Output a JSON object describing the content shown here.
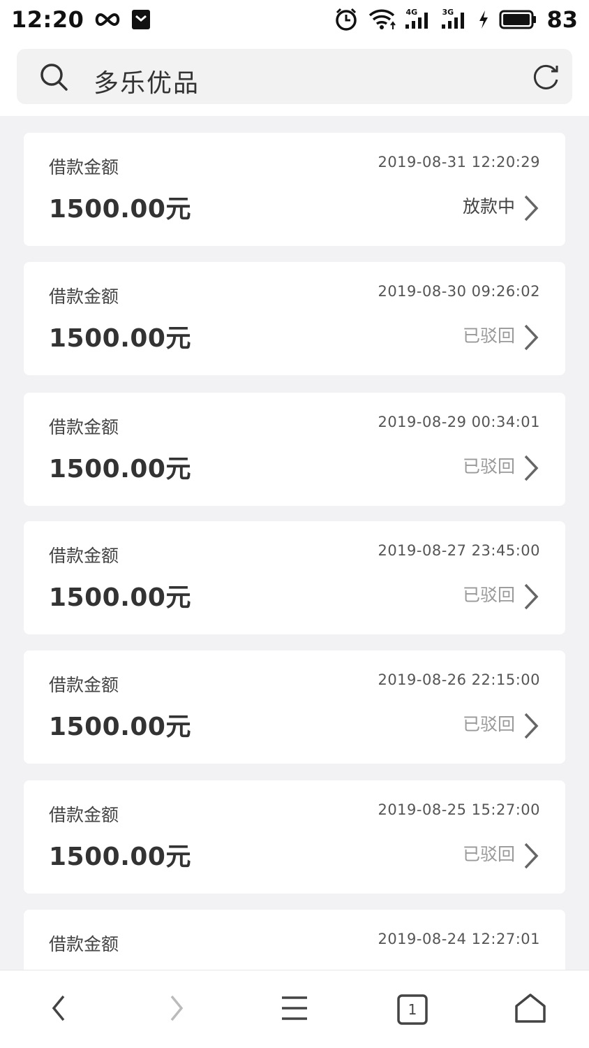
{
  "status_bar": {
    "time": "12:20",
    "battery": "83",
    "network_1": "4G",
    "network_2": "3G",
    "icons": [
      "infinity-icon",
      "shield-icon",
      "alarm-icon",
      "wifi-icon",
      "signal-4g-icon",
      "signal-3g-icon",
      "charging-icon",
      "battery-icon"
    ]
  },
  "search": {
    "query": "多乐优品",
    "icons": [
      "search-icon",
      "refresh-icon"
    ]
  },
  "records": [
    {
      "label": "借款金额",
      "amount": "1500.00元",
      "time": "2019-08-31 12:20:29",
      "status": "放款中",
      "active": true
    },
    {
      "label": "借款金额",
      "amount": "1500.00元",
      "time": "2019-08-30 09:26:02",
      "status": "已驳回",
      "active": false
    },
    {
      "label": "借款金额",
      "amount": "1500.00元",
      "time": "2019-08-29 00:34:01",
      "status": "已驳回",
      "active": false
    },
    {
      "label": "借款金额",
      "amount": "1500.00元",
      "time": "2019-08-27 23:45:00",
      "status": "已驳回",
      "active": false
    },
    {
      "label": "借款金额",
      "amount": "1500.00元",
      "time": "2019-08-26 22:15:00",
      "status": "已驳回",
      "active": false
    },
    {
      "label": "借款金额",
      "amount": "1500.00元",
      "time": "2019-08-25 15:27:00",
      "status": "已驳回",
      "active": false
    },
    {
      "label": "借款金额",
      "amount": "",
      "time": "2019-08-24 12:27:01",
      "status": "",
      "active": false
    }
  ],
  "bottom_nav": {
    "tab_count": "1",
    "icons": [
      "back-icon",
      "forward-icon",
      "menu-icon",
      "tabs-icon",
      "home-icon"
    ]
  },
  "colors": {
    "page_bg": "#f2f2f4",
    "card_bg": "#ffffff",
    "status_active": "#444444",
    "status_rejected": "#999999"
  }
}
